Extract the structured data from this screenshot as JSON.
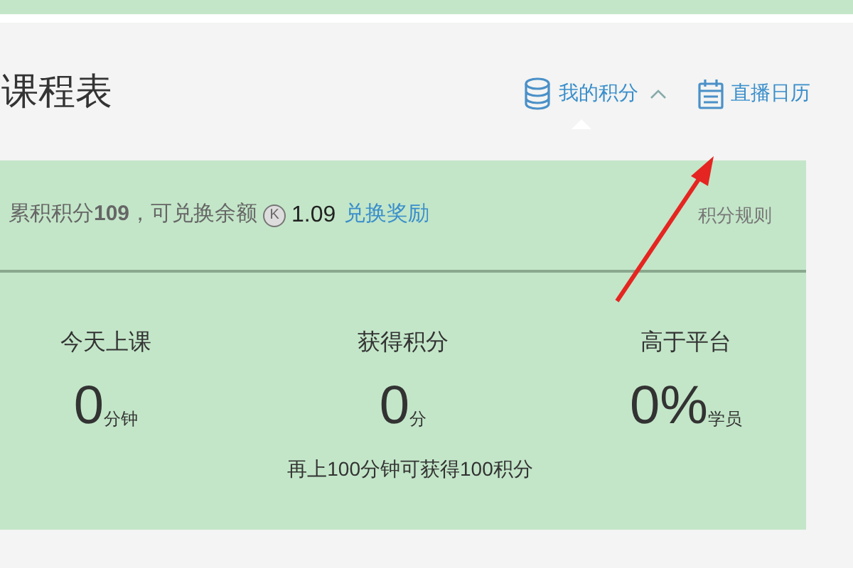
{
  "title": "课程表",
  "header_links": [
    {
      "kind": "points",
      "label": "我的积分",
      "expanded": true
    },
    {
      "kind": "calendar",
      "label": "直播日历"
    }
  ],
  "summary": {
    "text": "累积积分**109**，可兑换余额",
    "currency_mark": "K",
    "amount": "1.09",
    "link": "兑换奖励",
    "rules": "积分规则"
  },
  "stats": [
    {
      "label": "今天上课",
      "value": "0",
      "unit": "分钟"
    },
    {
      "label": "获得积分",
      "value": "0",
      "unit": "分"
    },
    {
      "label": "高于平台",
      "value": "0%",
      "unit": "学员"
    }
  ],
  "note": "再上100分钟可获得100积分"
}
